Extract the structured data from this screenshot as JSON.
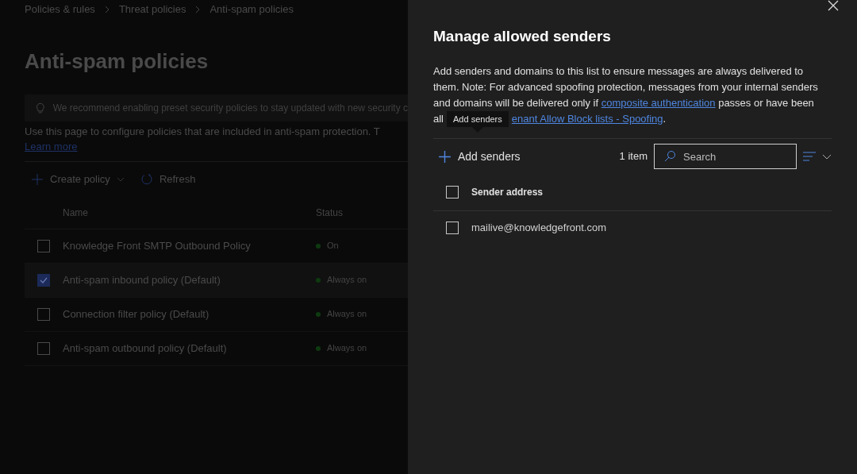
{
  "breadcrumb": [
    "Policies & rules",
    "Threat policies",
    "Anti-spam policies"
  ],
  "page_title": "Anti-spam policies",
  "notice": "We recommend enabling preset security policies to stay updated with new security c",
  "intro": "Use this page to configure policies that are included in anti-spam protection. T",
  "learn_more": "Learn more",
  "toolbar": [
    {
      "kind": "create",
      "label": "Create policy"
    },
    {
      "kind": "refresh",
      "label": "Refresh"
    }
  ],
  "table": {
    "columns": [
      "Name",
      "Status"
    ],
    "rows": [
      {
        "name": "Knowledge Front SMTP Outbound Policy",
        "status": "On",
        "selected": false
      },
      {
        "name": "Anti-spam inbound policy (Default)",
        "status": "Always on",
        "selected": true
      },
      {
        "name": "Connection filter policy (Default)",
        "status": "Always on",
        "selected": false
      },
      {
        "name": "Anti-spam outbound policy (Default)",
        "status": "Always on",
        "selected": false
      }
    ]
  },
  "panel": {
    "title": "Manage allowed senders",
    "description": "Add senders and domains to this list to ensure messages are always delivered to them. Note: For advanced spoofing protection, messages from your internal senders and domains will be delivered only if ",
    "link_1": "composite authentication",
    "description_2": " passes or have been",
    "description_3": "all",
    "link_2": "enant Allow Block lists - Spoofing",
    "description_end": ".",
    "tooltip": "Add senders",
    "add_button": "Add senders",
    "count": "1 item",
    "search": {
      "placeholder": "Search"
    },
    "column": "Sender address",
    "select_all": {
      "checked": false
    },
    "rows": [
      {
        "address": "mailive@knowledgefront.com",
        "selected": false
      }
    ]
  }
}
